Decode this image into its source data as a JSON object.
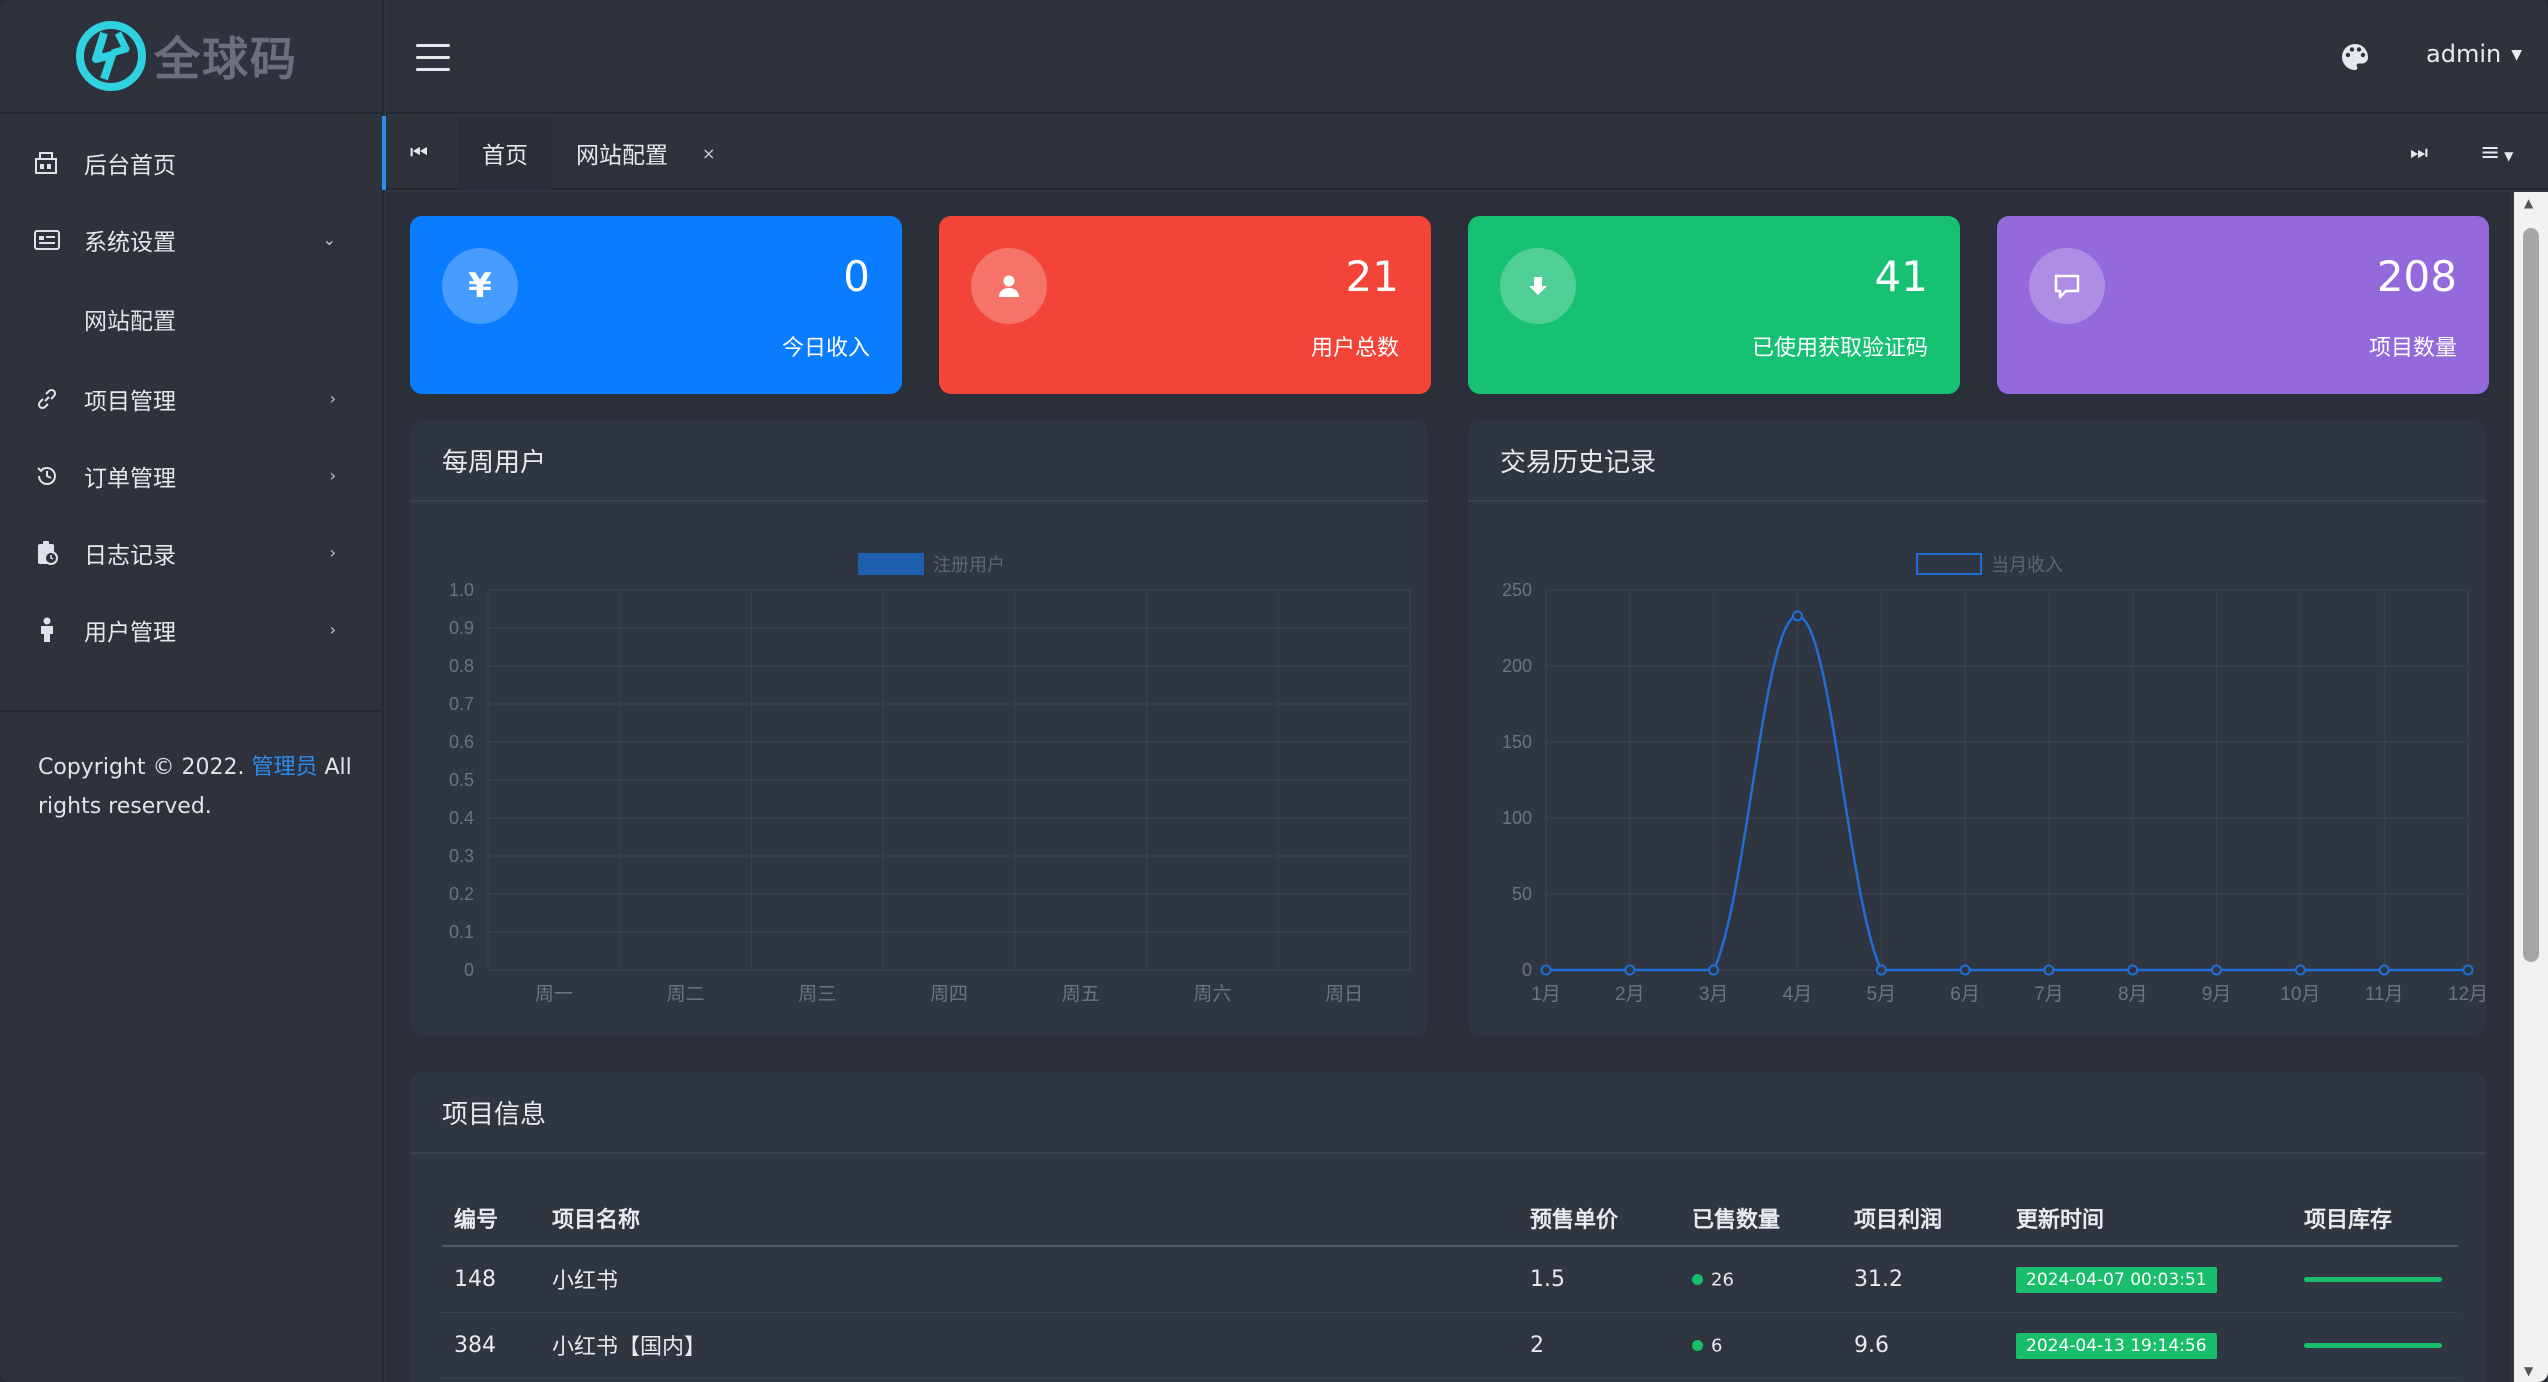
{
  "brand": {
    "name": "全球码",
    "accent": "#2ed2e0"
  },
  "header": {
    "user": "admin"
  },
  "sidebar": {
    "items": [
      {
        "label": "后台首页",
        "icon": "dashboard-icon"
      },
      {
        "label": "系统设置",
        "icon": "settings-card-icon",
        "expanded": true,
        "children": [
          {
            "label": "网站配置"
          }
        ]
      },
      {
        "label": "项目管理",
        "icon": "link-icon"
      },
      {
        "label": "订单管理",
        "icon": "history-icon"
      },
      {
        "label": "日志记录",
        "icon": "log-icon"
      },
      {
        "label": "用户管理",
        "icon": "user-icon"
      }
    ],
    "copyright": {
      "prefix": "Copyright © 2022.",
      "link": "管理员",
      "suffix": "All rights reserved."
    }
  },
  "tabs": {
    "items": [
      {
        "label": "首页"
      },
      {
        "label": "网站配置",
        "closable": true
      }
    ],
    "close_glyph": "×"
  },
  "stats": [
    {
      "value": "0",
      "label": "今日收入",
      "icon": "yen-icon",
      "color": "#0a7cff"
    },
    {
      "value": "21",
      "label": "用户总数",
      "icon": "user-icon",
      "color": "#f24537"
    },
    {
      "value": "41",
      "label": "已使用获取验证码",
      "icon": "download-icon",
      "color": "#16c173"
    },
    {
      "value": "208",
      "label": "项目数量",
      "icon": "message-icon",
      "color": "#9369dc"
    }
  ],
  "weekly_chart": {
    "title": "每周用户"
  },
  "history_chart": {
    "title": "交易历史记录"
  },
  "chart_data": [
    {
      "type": "bar",
      "title": "每周用户",
      "legend": [
        "注册用户"
      ],
      "legend_position": "top-center",
      "categories": [
        "周一",
        "周二",
        "周三",
        "周四",
        "周五",
        "周六",
        "周日"
      ],
      "series": [
        {
          "name": "注册用户",
          "values": [
            0,
            0,
            0,
            0,
            0,
            0,
            0
          ],
          "color": "#1f5fb0"
        }
      ],
      "ylim": [
        0,
        1
      ],
      "yticks": [
        "0",
        "0.1",
        "0.2",
        "0.3",
        "0.4",
        "0.5",
        "0.6",
        "0.7",
        "0.8",
        "0.9",
        "1.0"
      ],
      "grid": true
    },
    {
      "type": "line",
      "title": "交易历史记录",
      "legend": [
        "当月收入"
      ],
      "legend_position": "top-center",
      "categories": [
        "1月",
        "2月",
        "3月",
        "4月",
        "5月",
        "6月",
        "7月",
        "8月",
        "9月",
        "10月",
        "11月",
        "12月"
      ],
      "series": [
        {
          "name": "当月收入",
          "values": [
            0,
            0,
            0,
            233,
            0,
            0,
            0,
            0,
            0,
            0,
            0,
            0
          ],
          "color": "#1f6fd6"
        }
      ],
      "ylim": [
        0,
        250
      ],
      "yticks": [
        "0",
        "50",
        "100",
        "150",
        "200",
        "250"
      ],
      "grid": true
    }
  ],
  "projects": {
    "title": "项目信息",
    "columns": [
      "编号",
      "项目名称",
      "预售单价",
      "已售数量",
      "项目利润",
      "更新时间",
      "项目库存"
    ],
    "rows": [
      {
        "id": "148",
        "name": "小红书",
        "price": "1.5",
        "sold": "26",
        "profit": "31.2",
        "updated": "2024-04-07 00:03:51",
        "stock": 1.0
      },
      {
        "id": "384",
        "name": "小红书【国内】",
        "price": "2",
        "sold": "6",
        "profit": "9.6",
        "updated": "2024-04-13 19:14:56",
        "stock": 1.0
      }
    ]
  }
}
